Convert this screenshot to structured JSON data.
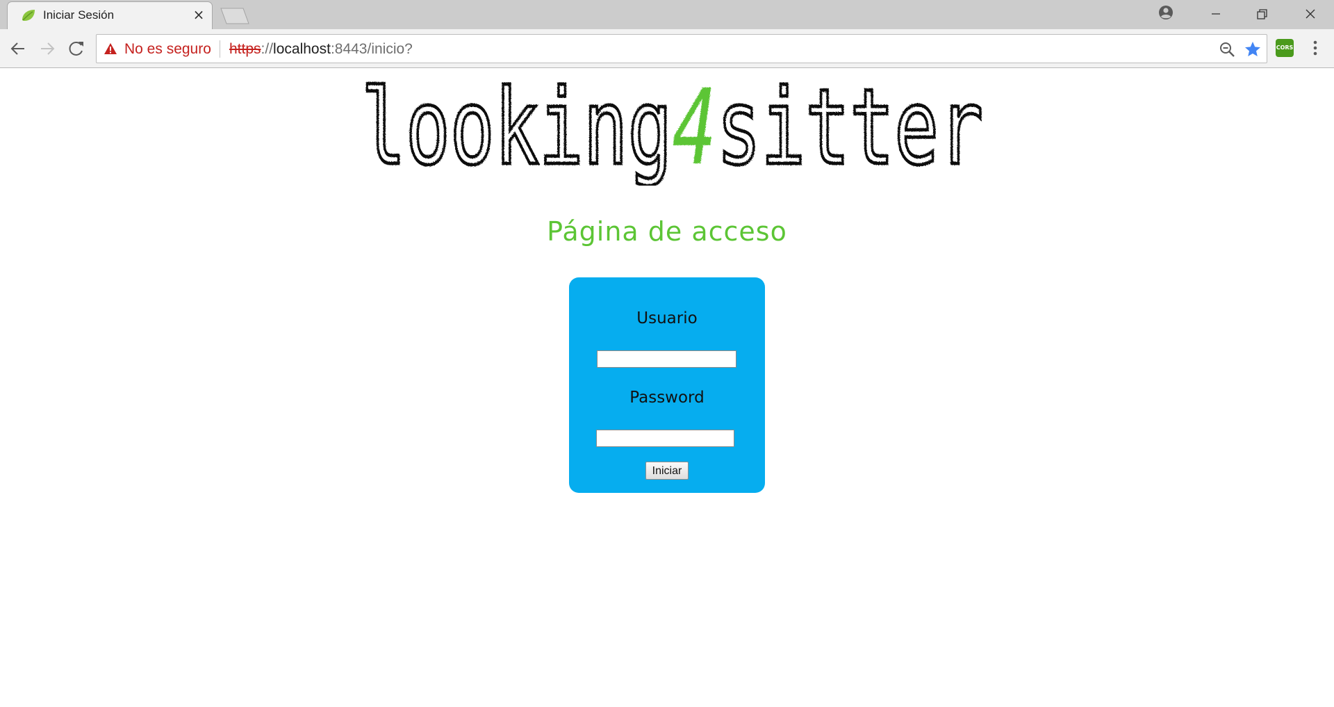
{
  "browser": {
    "tab": {
      "title": "Iniciar Sesión",
      "close_glyph": "×",
      "favicon": "spring-leaf-icon"
    },
    "address_bar": {
      "security_text": "No es seguro",
      "url_scheme": "https",
      "url_separator": "://",
      "url_host": "localhost",
      "url_rest": ":8443/inicio?"
    },
    "extension": {
      "label": "CORS"
    },
    "colors": {
      "insecure_red": "#c5221f",
      "star_blue": "#4285f4",
      "extension_green": "#4a9a1c"
    }
  },
  "page": {
    "logo": {
      "part1": "looking",
      "digit": "4",
      "part2": "sitter",
      "colors": {
        "text": "#111111",
        "digit": "#5cc535"
      }
    },
    "heading": "Página de acceso",
    "login_form": {
      "username_label": "Usuario",
      "username_value": "",
      "password_label": "Password",
      "password_value": "",
      "submit_label": "Iniciar",
      "colors": {
        "box": "#06adef",
        "heading": "#5cc535"
      }
    }
  }
}
